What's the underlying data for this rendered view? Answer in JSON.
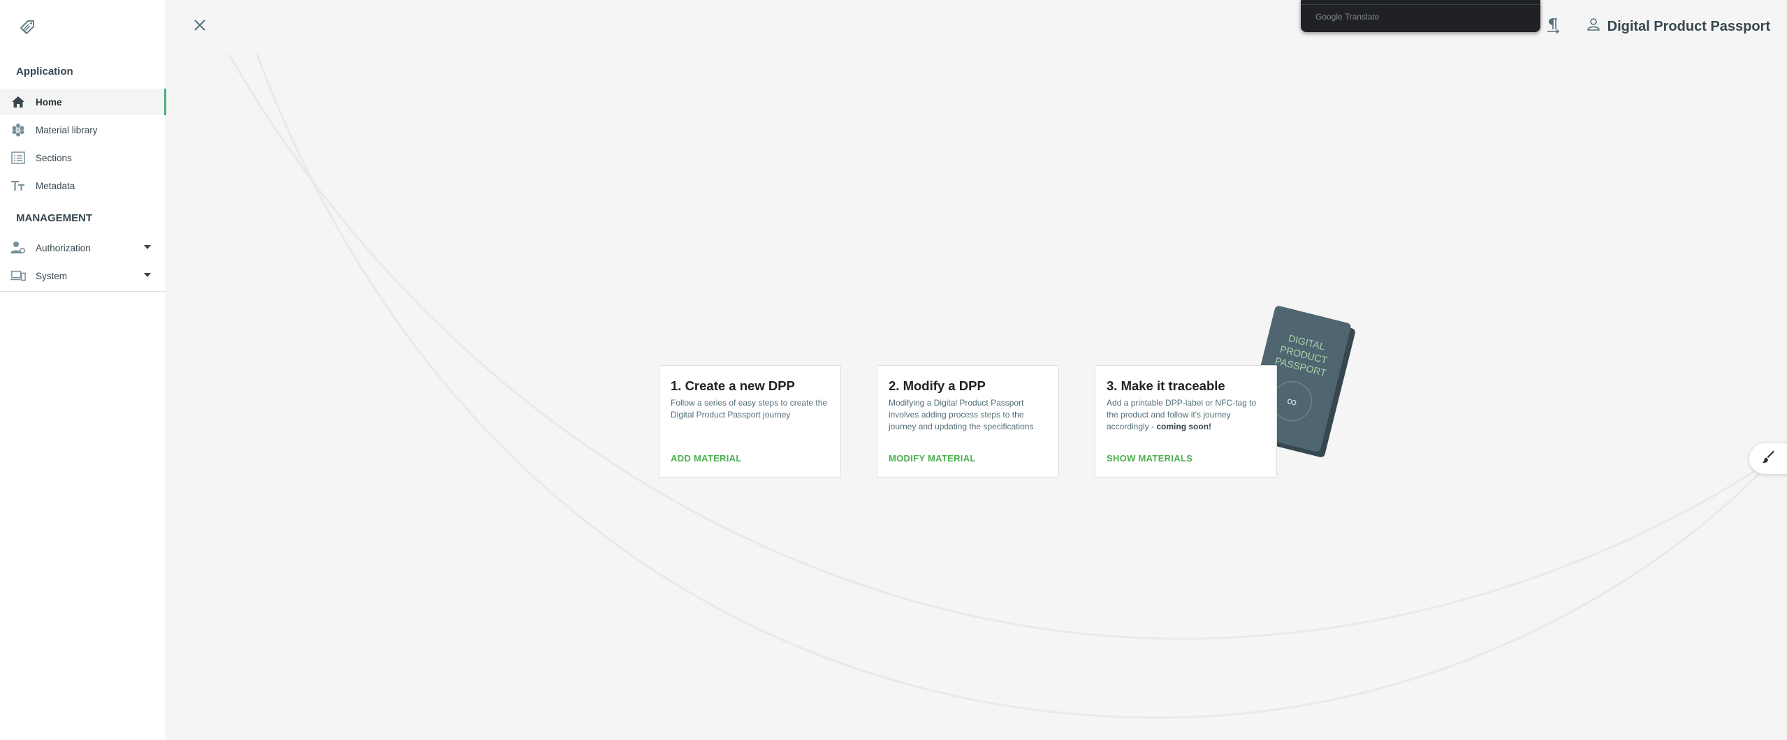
{
  "app": {
    "title": "Digital Product Passport"
  },
  "translate_popup": {
    "label": "Google Translate"
  },
  "sidebar": {
    "section_application": "Application",
    "section_management": "MANAGEMENT",
    "items": [
      {
        "label": "Home",
        "icon": "home-icon",
        "active": true
      },
      {
        "label": "Material library",
        "icon": "hexagon-cluster-icon"
      },
      {
        "label": "Sections",
        "icon": "list-icon"
      },
      {
        "label": "Metadata",
        "icon": "text-size-icon"
      },
      {
        "label": "Authorization",
        "icon": "user-cog-icon",
        "expandable": true
      },
      {
        "label": "System",
        "icon": "devices-icon",
        "expandable": true
      }
    ]
  },
  "cards": [
    {
      "title": "1. Create a new DPP",
      "description": "Follow a series of easy steps to create the Digital Product Passport journey",
      "action": "ADD MATERIAL"
    },
    {
      "title": "2. Modify a DPP",
      "description": "Modifying a Digital Product Passport involves adding process steps to the journey and updating the specifications",
      "action": "MODIFY MATERIAL"
    },
    {
      "title": "3. Make it traceable",
      "description": "Add a printable DPP-label or NFC-tag to the product and follow it's journey accordingly -",
      "description_bold": "coming soon!",
      "action": "SHOW MATERIALS"
    }
  ],
  "passport_image": {
    "lines": [
      "DIGITAL",
      "PRODUCT",
      "PASSPORT"
    ]
  },
  "colors": {
    "accent": "#4caf50",
    "active_border": "#4caf7d",
    "passport": "#455a64"
  }
}
